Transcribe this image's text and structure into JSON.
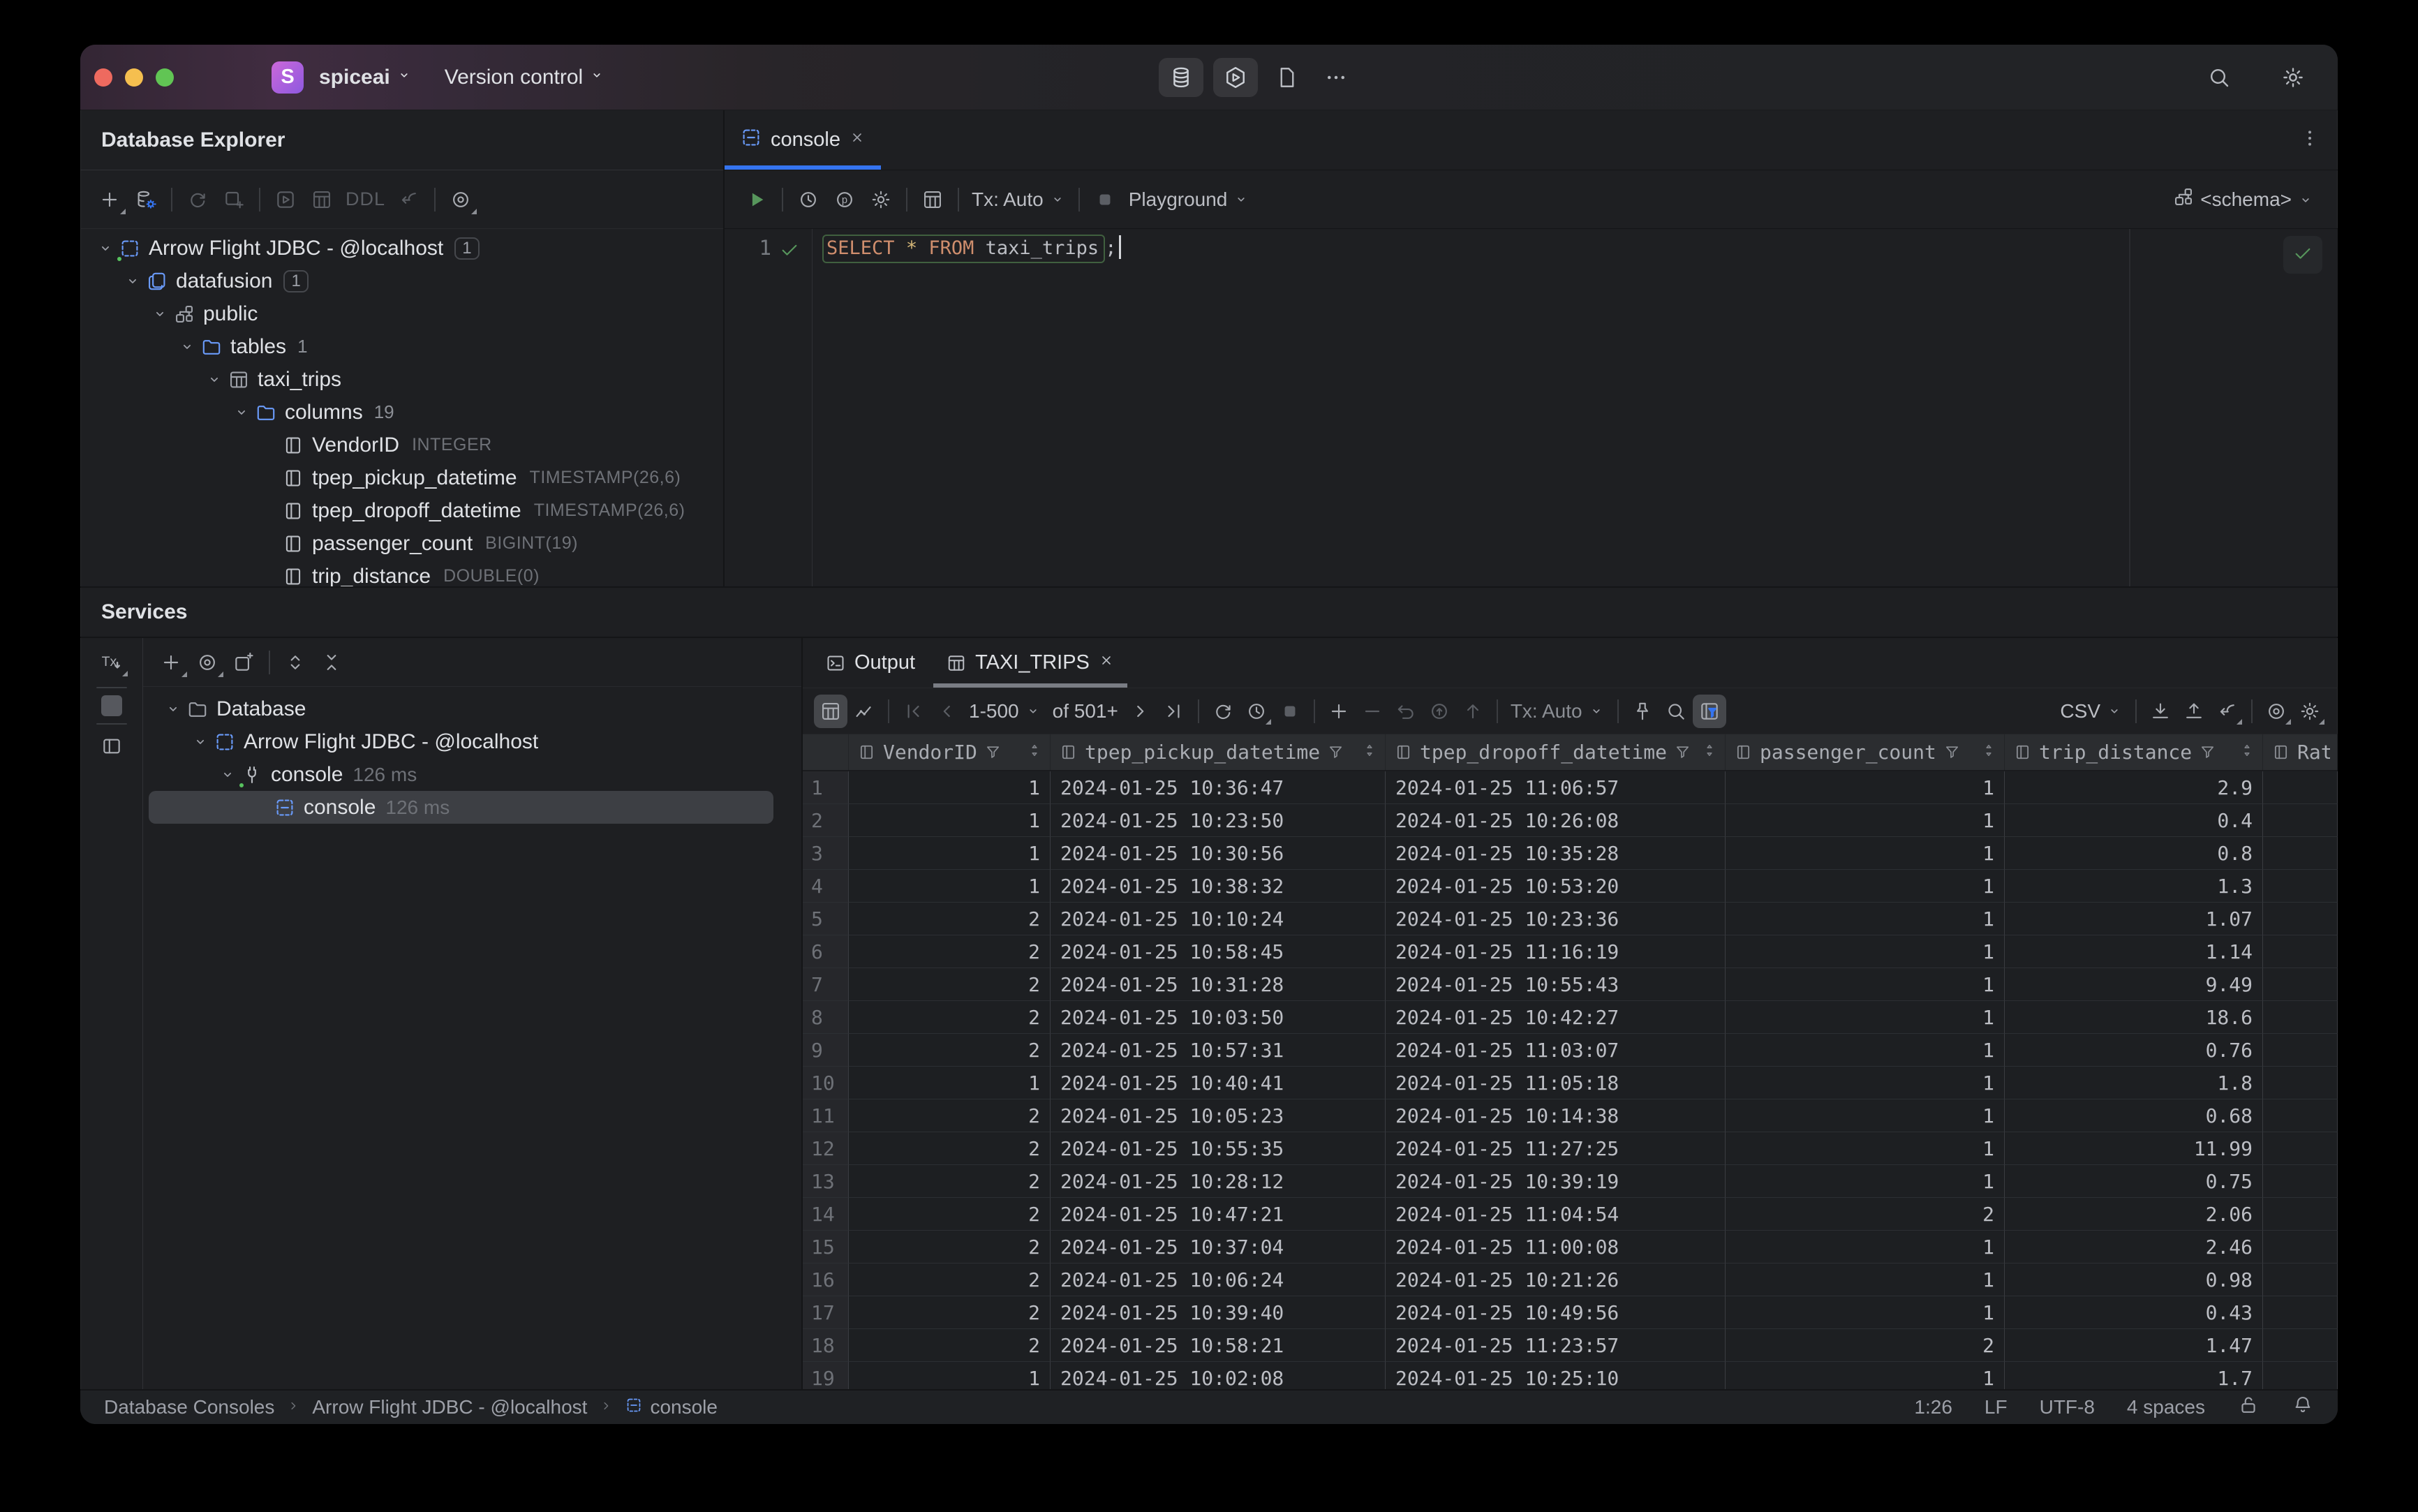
{
  "window": {
    "project": "spiceai",
    "menu_version_control": "Version control",
    "app_initial": "S"
  },
  "titlebar": {
    "center_buttons": [
      {
        "icon": "db-stack",
        "name": "database-tool-button",
        "boxed": true
      },
      {
        "icon": "hex-play",
        "name": "services-tool-button",
        "boxed": true
      },
      {
        "icon": "file",
        "name": "project-files-button"
      },
      {
        "icon": "ellipsis",
        "name": "more-tool-windows-button"
      }
    ],
    "right_buttons": [
      {
        "icon": "search",
        "name": "search-everywhere-button"
      },
      {
        "icon": "gear",
        "name": "settings-button"
      }
    ]
  },
  "db_explorer": {
    "title": "Database Explorer",
    "toolbar": [
      {
        "icon": "plus",
        "name": "new-datasource-button",
        "dd": true
      },
      {
        "icon": "db-gear",
        "name": "datasource-properties-button"
      },
      {
        "sep": true
      },
      {
        "icon": "refresh",
        "name": "refresh-button",
        "disabled": true
      },
      {
        "icon": "console-add",
        "name": "query-console-button",
        "disabled": true
      },
      {
        "sep": true
      },
      {
        "icon": "play-frame",
        "name": "open-editor-button",
        "disabled": true
      },
      {
        "icon": "table-grid",
        "name": "view-data-button",
        "disabled": true
      },
      {
        "text": "DDL",
        "name": "ddl-button",
        "disabled": true
      },
      {
        "icon": "jump-source",
        "name": "scroll-to-source-button",
        "disabled": true
      },
      {
        "sep": true
      },
      {
        "icon": "target",
        "name": "view-options-button",
        "dd": true
      }
    ],
    "tree": [
      {
        "level": 0,
        "icon": "datasource",
        "color": "blue",
        "chevron": true,
        "label": "Arrow Flight JDBC - @localhost",
        "badge": "1",
        "boxed": true,
        "status_dot": true
      },
      {
        "level": 1,
        "icon": "database",
        "color": "blue",
        "chevron": true,
        "label": "datafusion",
        "badge": "1",
        "boxed": true
      },
      {
        "level": 2,
        "icon": "schema",
        "color": "gray",
        "chevron": true,
        "label": "public"
      },
      {
        "level": 3,
        "icon": "folder",
        "color": "blue",
        "chevron": true,
        "label": "tables",
        "badge": "1"
      },
      {
        "level": 4,
        "icon": "table",
        "color": "gray",
        "chevron": true,
        "label": "taxi_trips"
      },
      {
        "level": 5,
        "icon": "folder",
        "color": "blue",
        "chevron": true,
        "label": "columns",
        "badge": "19"
      },
      {
        "level": 6,
        "icon": "column",
        "color": "light",
        "label": "VendorID",
        "type": "INTEGER"
      },
      {
        "level": 6,
        "icon": "column",
        "color": "light",
        "label": "tpep_pickup_datetime",
        "type": "TIMESTAMP(26,6)"
      },
      {
        "level": 6,
        "icon": "column",
        "color": "light",
        "label": "tpep_dropoff_datetime",
        "type": "TIMESTAMP(26,6)"
      },
      {
        "level": 6,
        "icon": "column",
        "color": "light",
        "label": "passenger_count",
        "type": "BIGINT(19)"
      },
      {
        "level": 6,
        "icon": "column",
        "color": "light",
        "label": "trip_distance",
        "type": "DOUBLE(0)"
      }
    ]
  },
  "editor": {
    "tab": {
      "label": "console",
      "icon": "console-file"
    },
    "toolbar": [
      {
        "icon": "run",
        "name": "run-button",
        "green": true
      },
      {
        "sep": true
      },
      {
        "icon": "clock",
        "name": "query-history-button"
      },
      {
        "icon": "p-circle",
        "name": "parameters-button"
      },
      {
        "icon": "gear",
        "name": "console-settings-button"
      },
      {
        "sep": true
      },
      {
        "icon": "table-grid",
        "name": "browse-data-button"
      },
      {
        "sep": true
      },
      {
        "label": "Tx: Auto",
        "name": "tx-mode-select",
        "chev": true
      },
      {
        "sep": true
      },
      {
        "icon": "stop",
        "name": "stop-button",
        "disabled": true
      },
      {
        "label": "Playground",
        "name": "playground-select",
        "chev": true
      }
    ],
    "schema_select": {
      "label": "<schema>",
      "icon": "schema"
    },
    "line_number": "1",
    "sql_tokens": [
      {
        "text": "SELECT",
        "type": "keyword"
      },
      {
        "text": " ",
        "type": "plain"
      },
      {
        "text": "*",
        "type": "star"
      },
      {
        "text": " ",
        "type": "plain"
      },
      {
        "text": "FROM",
        "type": "keyword"
      },
      {
        "text": " taxi_trips",
        "type": "plain"
      }
    ],
    "sql_tail": ";"
  },
  "services": {
    "title": "Services",
    "rail": {
      "tx_label": "Tx"
    },
    "toolbar": [
      {
        "icon": "plus",
        "name": "add-service-button",
        "dd": true
      },
      {
        "icon": "target",
        "name": "view-options-button",
        "dd": true
      },
      {
        "icon": "open-new",
        "name": "open-in-new-tab-button"
      },
      {
        "sep": true
      },
      {
        "icon": "expand",
        "name": "expand-all-button"
      },
      {
        "icon": "collapse",
        "name": "collapse-all-button"
      }
    ],
    "tree": [
      {
        "level": 0,
        "icon": "folder-plain",
        "color": "gray",
        "chevron": true,
        "label": "Database"
      },
      {
        "level": 1,
        "icon": "datasource",
        "color": "blue",
        "chevron": true,
        "label": "Arrow Flight JDBC - @localhost"
      },
      {
        "level": 2,
        "icon": "plug",
        "color": "light",
        "chevron": true,
        "label": "console",
        "meta": "126 ms",
        "status_dot": true
      },
      {
        "level": 3,
        "icon": "console-file",
        "color": "blue",
        "label": "console",
        "meta": "126 ms",
        "selected": true
      }
    ]
  },
  "results": {
    "tabs": [
      {
        "label": "Output",
        "icon": "terminal",
        "name": "tab-output"
      },
      {
        "label": "TAXI_TRIPS",
        "icon": "table",
        "name": "tab-taxi-trips",
        "active": true,
        "closable": true
      }
    ],
    "toolbar_left": [
      {
        "icon": "table-grid",
        "name": "table-view-button",
        "active": true
      },
      {
        "icon": "chart",
        "name": "chart-view-button"
      },
      {
        "sep": true
      },
      {
        "icon": "page-first",
        "name": "first-page-button",
        "disabled": true
      },
      {
        "icon": "page-prev",
        "name": "previous-page-button",
        "disabled": true
      },
      {
        "label": "1-500",
        "name": "page-range-select",
        "chev": true
      },
      {
        "label": "of 501+",
        "name": "total-rows-label",
        "plain": true
      },
      {
        "icon": "page-next",
        "name": "next-page-button"
      },
      {
        "icon": "page-last",
        "name": "last-page-button"
      },
      {
        "sep": true
      },
      {
        "icon": "refresh",
        "name": "reload-page-button"
      },
      {
        "icon": "clock",
        "name": "execution-history-button",
        "dd": true
      },
      {
        "icon": "stop",
        "name": "stop-query-button",
        "disabled": true
      },
      {
        "sep": true
      },
      {
        "icon": "plus",
        "name": "add-row-button"
      },
      {
        "icon": "minus",
        "name": "delete-row-button",
        "disabled": true
      },
      {
        "icon": "undo",
        "name": "revert-button",
        "disabled": true
      },
      {
        "icon": "revert",
        "name": "rollback-button",
        "disabled": true
      },
      {
        "icon": "arrow-up",
        "name": "submit-button",
        "disabled": true
      },
      {
        "sep": true
      },
      {
        "label": "Tx: Auto",
        "name": "grid-tx-mode-select",
        "chev": true,
        "muted": true
      },
      {
        "sep": true
      },
      {
        "icon": "pin",
        "name": "pin-tab-button"
      },
      {
        "icon": "search",
        "name": "find-in-grid-button"
      },
      {
        "icon": "filter-panel",
        "name": "filter-panel-button",
        "active": true
      }
    ],
    "toolbar_right": [
      {
        "label": "CSV",
        "name": "export-format-select",
        "chev": true
      },
      {
        "sep": true
      },
      {
        "icon": "download",
        "name": "import-button"
      },
      {
        "icon": "upload",
        "name": "export-button"
      },
      {
        "icon": "jump-source",
        "name": "edit-as-table-button",
        "dd": true
      },
      {
        "sep": true
      },
      {
        "icon": "target",
        "name": "grid-view-options-button",
        "dd": true
      },
      {
        "icon": "gear",
        "name": "grid-settings-button",
        "dd": true
      }
    ],
    "grid": {
      "columns": [
        {
          "label": "VendorID",
          "align": "right",
          "filter": true,
          "sort": true
        },
        {
          "label": "tpep_pickup_datetime",
          "align": "left",
          "filter": true,
          "sort": true
        },
        {
          "label": "tpep_dropoff_datetime",
          "align": "left",
          "filter": true,
          "sort": true
        },
        {
          "label": "passenger_count",
          "align": "right",
          "filter": true,
          "sort": true
        },
        {
          "label": "trip_distance",
          "align": "right",
          "filter": true,
          "sort": true
        },
        {
          "label": "Rate",
          "align": "left",
          "filter": false,
          "sort": false
        }
      ],
      "rows": [
        [
          "1",
          "2024-01-25 10:36:47",
          "2024-01-25 11:06:57",
          "1",
          "2.9"
        ],
        [
          "1",
          "2024-01-25 10:23:50",
          "2024-01-25 10:26:08",
          "1",
          "0.4"
        ],
        [
          "1",
          "2024-01-25 10:30:56",
          "2024-01-25 10:35:28",
          "1",
          "0.8"
        ],
        [
          "1",
          "2024-01-25 10:38:32",
          "2024-01-25 10:53:20",
          "1",
          "1.3"
        ],
        [
          "2",
          "2024-01-25 10:10:24",
          "2024-01-25 10:23:36",
          "1",
          "1.07"
        ],
        [
          "2",
          "2024-01-25 10:58:45",
          "2024-01-25 11:16:19",
          "1",
          "1.14"
        ],
        [
          "2",
          "2024-01-25 10:31:28",
          "2024-01-25 10:55:43",
          "1",
          "9.49"
        ],
        [
          "2",
          "2024-01-25 10:03:50",
          "2024-01-25 10:42:27",
          "1",
          "18.6"
        ],
        [
          "2",
          "2024-01-25 10:57:31",
          "2024-01-25 11:03:07",
          "1",
          "0.76"
        ],
        [
          "1",
          "2024-01-25 10:40:41",
          "2024-01-25 11:05:18",
          "1",
          "1.8"
        ],
        [
          "2",
          "2024-01-25 10:05:23",
          "2024-01-25 10:14:38",
          "1",
          "0.68"
        ],
        [
          "2",
          "2024-01-25 10:55:35",
          "2024-01-25 11:27:25",
          "1",
          "11.99"
        ],
        [
          "2",
          "2024-01-25 10:28:12",
          "2024-01-25 10:39:19",
          "1",
          "0.75"
        ],
        [
          "2",
          "2024-01-25 10:47:21",
          "2024-01-25 11:04:54",
          "2",
          "2.06"
        ],
        [
          "2",
          "2024-01-25 10:37:04",
          "2024-01-25 11:00:08",
          "1",
          "2.46"
        ],
        [
          "2",
          "2024-01-25 10:06:24",
          "2024-01-25 10:21:26",
          "1",
          "0.98"
        ],
        [
          "2",
          "2024-01-25 10:39:40",
          "2024-01-25 10:49:56",
          "1",
          "0.43"
        ],
        [
          "2",
          "2024-01-25 10:58:21",
          "2024-01-25 11:23:57",
          "2",
          "1.47"
        ],
        [
          "1",
          "2024-01-25 10:02:08",
          "2024-01-25 10:25:10",
          "1",
          "1.7"
        ]
      ]
    }
  },
  "statusbar": {
    "breadcrumbs": [
      {
        "label": "Database Consoles"
      },
      {
        "label": "Arrow Flight JDBC - @localhost"
      },
      {
        "label": "console",
        "icon": "console-file"
      }
    ],
    "caret_position": "1:26",
    "line_separator": "LF",
    "encoding": "UTF-8",
    "indent": "4 spaces",
    "right_icons": [
      {
        "icon": "lock-open"
      },
      {
        "icon": "bell"
      }
    ]
  }
}
